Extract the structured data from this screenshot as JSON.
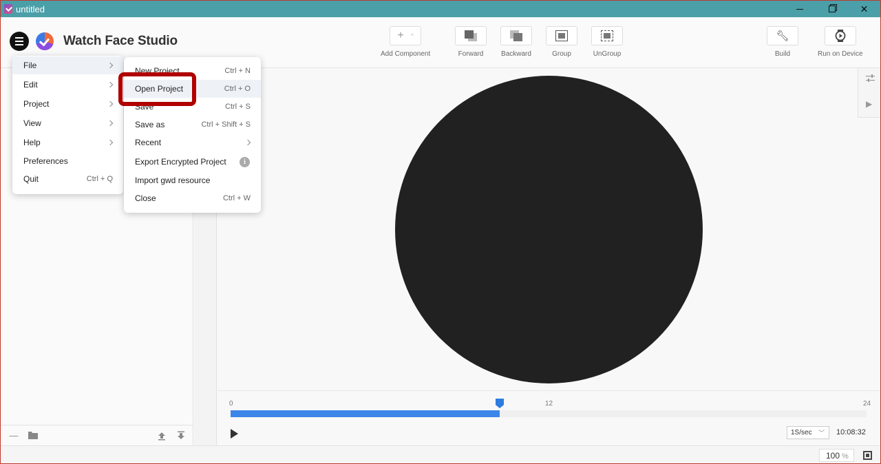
{
  "window": {
    "title": "untitled"
  },
  "app": {
    "name": "Watch Face Studio"
  },
  "toolbar": {
    "add_component": "Add Component",
    "forward": "Forward",
    "backward": "Backward",
    "group": "Group",
    "ungroup": "UnGroup",
    "build": "Build",
    "run_on_device": "Run on Device"
  },
  "main_menu": {
    "items": [
      {
        "label": "File",
        "submenu": true
      },
      {
        "label": "Edit",
        "submenu": true
      },
      {
        "label": "Project",
        "submenu": true
      },
      {
        "label": "View",
        "submenu": true
      },
      {
        "label": "Help",
        "submenu": true
      },
      {
        "label": "Preferences",
        "shortcut": ""
      },
      {
        "label": "Quit",
        "shortcut": "Ctrl + Q"
      }
    ]
  },
  "file_menu": {
    "items": [
      {
        "label": "New Project",
        "shortcut": "Ctrl + N"
      },
      {
        "label": "Open Project",
        "shortcut": "Ctrl + O"
      },
      {
        "label": "Save",
        "shortcut": "Ctrl + S"
      },
      {
        "label": "Save as",
        "shortcut": "Ctrl + Shift + S"
      },
      {
        "label": "Recent",
        "shortcut": ""
      },
      {
        "label": "Export Encrypted Project",
        "shortcut": ""
      },
      {
        "label": "Import gwd resource",
        "shortcut": ""
      },
      {
        "label": "Close",
        "shortcut": "Ctrl + W"
      }
    ]
  },
  "timeline": {
    "tick_start": "0",
    "tick_mid": "12",
    "tick_end": "24",
    "progress": 0.423,
    "speed": "1S/sec",
    "time": "10:08:32"
  },
  "status": {
    "zoom_value": "100",
    "zoom_unit": "%"
  },
  "colors": {
    "titlebar": "#4a9fa8",
    "accent": "#3b86e8",
    "watch_face": "#212121",
    "highlight": "#b00000"
  }
}
